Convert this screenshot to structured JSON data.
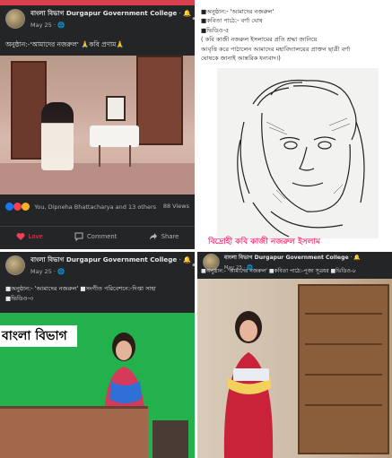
{
  "posts": [
    {
      "page_name": "বাংলা বিভাগ Durgapur Government College",
      "date": "May 25",
      "caption": "অনুষ্ঠান:-'আমাদের নজরুল'        🙏কবি প্রণাম🙏",
      "reactions_text": "You, Dipneha Bhattacharya and 13 others",
      "views": "88 Views",
      "actions": [
        "Love",
        "Comment",
        "Share"
      ]
    },
    {
      "caption_lines": [
        "■অনুষ্ঠান:- 'আমাদের নজরুল'",
        "■কবিতা পাঠে:- বর্ণা ঘোষ",
        "■ভিডিও-৫",
        "( কবি কাজী নজরুল ইসলামের প্রতি শ্রদ্ধা জানিয়ে",
        "আবৃত্তি করে পাঠালেন আমাদের মহাবিদ্যালয়ের প্রাক্তন ছাত্রী বর্ণা",
        "ঘোষকে জানাই আন্তরিক ধন্যবাদ।)"
      ],
      "overlay_text": "বিদ্রোহী কবি কাজী নজরুল ইসলাম"
    },
    {
      "page_name": "বাংলা বিভাগ Durgapur Government College",
      "date": "May 25",
      "caption": "■অনুষ্ঠান:- 'আমাদের নজরুল' ■সংগীত পরিবেশনে:-দিপ্তা সাহা",
      "caption2": "■ভিডিও-৩",
      "banner": "বাংলা বিভাগ"
    },
    {
      "page_name": "বাংলা বিভাগ Durgapur Government College",
      "date": "May 25",
      "caption": "■অনুষ্ঠান:- 'আমাদের নজরুল' ■কবিতা পাঠে:-পূজা সূত্রধর ■ভিডিও-৮"
    }
  ],
  "colors": {
    "fb_dark": "#242526",
    "green_screen": "#22b14c",
    "love_red": "#f33e58",
    "overlay_pink": "#ff3a80"
  }
}
